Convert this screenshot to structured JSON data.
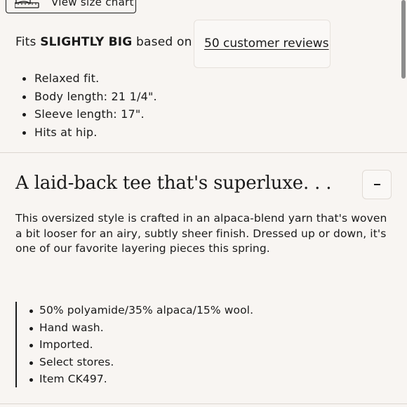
{
  "size_chart": {
    "label": "View size chart",
    "icon": "ruler-icon"
  },
  "fit": {
    "prefix": "Fits",
    "verdict": "SLIGHTLY BIG",
    "suffix": "based on",
    "reviews_link": "50 customer reviews"
  },
  "fit_details": [
    "Relaxed fit.",
    "Body length: 21 1/4\".",
    "Sleeve length: 17\".",
    "Hits at hip."
  ],
  "description_section": {
    "title": "A laid-back tee that's superluxe. . .",
    "toggle_label": "-",
    "body": "This oversized style is crafted in an alpaca-blend yarn that's woven a bit looser for an airy, subtly sheer finish. Dressed up or down, it's one of our favorite layering pieces this spring."
  },
  "product_details": [
    "50% polyamide/35% alpaca/15% wool.",
    "Hand wash.",
    "Imported.",
    "Select stores.",
    "Item CK497."
  ],
  "colors": {
    "background": "#f8f5f2",
    "text": "#1a1a1a",
    "divider": "#dcd6d0"
  }
}
